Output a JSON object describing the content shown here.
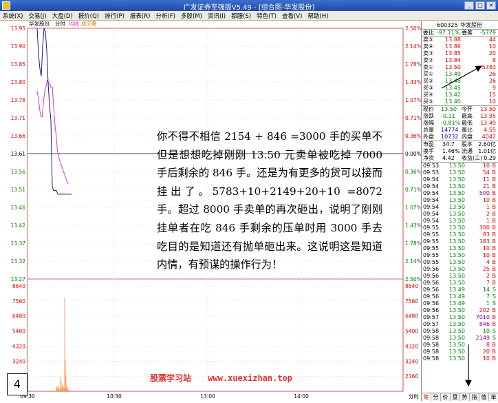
{
  "window": {
    "title": "广发证券至强版V5.49 - [组合图-华发股份]",
    "min": "_",
    "max": "□",
    "close": "×"
  },
  "menu": [
    "系统(X)",
    "交易(J)",
    "大盘(D)",
    "报价(Q)",
    "排行(P)",
    "报表(R)",
    "分析(F)",
    "多股(M)",
    "资讯(I)",
    "都服(S)",
    "特色(T)",
    "查看(V)",
    "帮助(H)"
  ],
  "chart": {
    "stock_name": "华发股份",
    "view_label": "分时",
    "avg_legend": "均线",
    "vol_legend": "成交量",
    "price_ticks": [
      "13.95",
      "13.90",
      "13.85",
      "13.80",
      "13.76",
      "13.71",
      "13.66",
      "13.61",
      "13.56",
      "13.51",
      "13.46",
      "13.42",
      "13.37",
      "13.32",
      "13.27"
    ],
    "pct_ticks": [
      "2.50%",
      "2.14%",
      "1.78%",
      "1.43%",
      "1.07%",
      "0.71%",
      "0.36%",
      "0.00%",
      "0.36%",
      "0.71%",
      "1.07%",
      "1.43%",
      "1.78%",
      "2.14%",
      "2.50%"
    ],
    "vol_ticks": [
      "8640",
      "7560",
      "6480",
      "5400",
      "4320",
      "3240",
      "2160"
    ],
    "time_ticks": [
      "09:30",
      "10:30",
      "13:00",
      "14:00"
    ],
    "time_label": "分时"
  },
  "chart_data": {
    "type": "line",
    "title": "华发股份 分时",
    "xlabel": "",
    "ylabel": "",
    "ylim": [
      13.27,
      13.95
    ],
    "prev_close": 13.61,
    "series": [
      {
        "name": "价格",
        "values": [
          13.95,
          13.88,
          13.84,
          13.82,
          13.9,
          13.95,
          13.94,
          13.89,
          13.8,
          13.74,
          13.7,
          13.52,
          13.51,
          13.51,
          13.51,
          13.5,
          13.5,
          13.5,
          13.5,
          13.5,
          13.5,
          13.5,
          13.5,
          13.5,
          13.5,
          13.5
        ]
      },
      {
        "name": "均线",
        "values": [
          13.78,
          13.76,
          13.73,
          13.71,
          13.71,
          13.75,
          13.78,
          13.79,
          13.81,
          13.8,
          13.8,
          13.79,
          13.79,
          13.74,
          13.69,
          13.66,
          13.62,
          13.6,
          13.59,
          13.58,
          13.57,
          13.56,
          13.55,
          13.54,
          13.53,
          13.53
        ]
      },
      {
        "name": "成交量",
        "values": [
          400,
          350,
          250,
          500,
          200,
          150,
          1200,
          800,
          300,
          600,
          400,
          300,
          7700,
          2600,
          1300,
          400,
          300,
          200,
          0,
          0,
          0,
          0,
          0,
          0,
          0,
          0
        ]
      }
    ],
    "vol_ylim": [
      0,
      8640
    ]
  },
  "quote": {
    "code": "600325",
    "name": "华发股份",
    "webi": {
      "label": "委比",
      "value": "-97.11%",
      "label2": "委差",
      "value2": "-5779"
    },
    "sells": [
      {
        "label": "卖⑤",
        "price": "13.88",
        "vol": "44"
      },
      {
        "label": "卖④",
        "price": "13.86",
        "vol": "10"
      },
      {
        "label": "卖③",
        "price": "13.85",
        "vol": "20"
      },
      {
        "label": "卖②",
        "price": "13.84",
        "vol": "8"
      },
      {
        "label": "卖①",
        "price": "13.50",
        "vol": "5783"
      }
    ],
    "buys": [
      {
        "label": "买①",
        "price": "13.49",
        "vol": "26"
      },
      {
        "label": "买②",
        "price": "13.48",
        "vol": "26"
      },
      {
        "label": "买③",
        "price": "13.45",
        "vol": "9"
      },
      {
        "label": "买④",
        "price": "13.42",
        "vol": "15"
      },
      {
        "label": "买⑤",
        "price": "13.40",
        "vol": "10"
      }
    ],
    "stats": [
      {
        "l1": "现价",
        "v1": "13.50",
        "l2": "今开",
        "v2": "13.50"
      },
      {
        "l1": "涨跌",
        "v1": "-0.11",
        "l2": "最高",
        "v2": "13.95"
      },
      {
        "l1": "涨幅",
        "v1": "-0.81%",
        "l2": "最低",
        "v2": "13.49"
      },
      {
        "l1": "总量",
        "v1": "14774",
        "l2": "量比",
        "v2": "4.55"
      },
      {
        "l1": "外盘",
        "v1": "10732",
        "l2": "内盘",
        "v2": "4042"
      }
    ],
    "stats2": [
      {
        "l1": "市盈",
        "v1": "34.7",
        "l2": "股本",
        "v2": "2.60亿"
      },
      {
        "l1": "换手",
        "v1": "1.46%",
        "l2": "流通",
        "v2": "1.01亿"
      },
      {
        "l1": "净资",
        "v1": "4.42",
        "l2": "收益(三)",
        "v2": "0.29"
      }
    ],
    "ticks": [
      {
        "time": "09:53",
        "price": "13.50",
        "vol": "10",
        "side": "B"
      },
      {
        "time": "09:53",
        "price": "13.50",
        "vol": "54",
        "side": "B"
      },
      {
        "time": "09:54",
        "price": "13.50",
        "vol": "11",
        "side": "B"
      },
      {
        "time": "09:54",
        "price": "13.50",
        "vol": "21",
        "side": "B"
      },
      {
        "time": "09:54",
        "price": "13.50",
        "vol": "500",
        "side": "B"
      },
      {
        "time": "09:54",
        "price": "13.50",
        "vol": "10",
        "side": "B"
      },
      {
        "time": "09:54",
        "price": "13.50",
        "vol": "1",
        "side": "B"
      },
      {
        "time": "09:54",
        "price": "13.50",
        "vol": "2",
        "side": "B"
      },
      {
        "time": "09:54",
        "price": "13.50",
        "vol": "1",
        "side": "B"
      },
      {
        "time": "09:55",
        "price": "13.50",
        "vol": "300",
        "side": "B"
      },
      {
        "time": "09:55",
        "price": "13.50",
        "vol": "83",
        "side": "B"
      },
      {
        "time": "09:55",
        "price": "13.50",
        "vol": "183",
        "side": "B"
      },
      {
        "time": "09:55",
        "price": "13.50",
        "vol": "10",
        "side": "B"
      },
      {
        "time": "09:55",
        "price": "13.50",
        "vol": "10",
        "side": "B"
      },
      {
        "time": "09:55",
        "price": "13.50",
        "vol": "4",
        "side": "B"
      },
      {
        "time": "09:56",
        "price": "13.50",
        "vol": "25",
        "side": "B"
      },
      {
        "time": "09:56",
        "price": "13.50",
        "vol": "2",
        "side": "B"
      },
      {
        "time": "09:56",
        "price": "13.50",
        "vol": "7",
        "side": "B"
      },
      {
        "time": "09:56",
        "price": "13.49",
        "vol": "14",
        "side": "S"
      },
      {
        "time": "09:56",
        "price": "13.49",
        "vol": "7",
        "side": "S"
      },
      {
        "time": "09:56",
        "price": "13.49",
        "vol": "1",
        "side": "S"
      },
      {
        "time": "09:56",
        "price": "13.50",
        "vol": "202",
        "side": "B"
      },
      {
        "time": "09:57",
        "price": "13.50",
        "vol": "7010",
        "side": "B"
      },
      {
        "time": "09:57",
        "price": "13.50",
        "vol": "846",
        "side": "B"
      },
      {
        "time": "09:58",
        "price": "13.50",
        "vol": "10",
        "side": "S"
      },
      {
        "time": "09:58",
        "price": "13.50",
        "vol": "2149",
        "side": "S"
      },
      {
        "time": "09:58",
        "price": "13.50",
        "vol": "8",
        "side": "B"
      },
      {
        "time": "09:58",
        "price": "13.50",
        "vol": "20",
        "side": "B"
      },
      {
        "time": "09:58",
        "price": "13.50",
        "vol": "10",
        "side": "B"
      }
    ],
    "tabs": [
      "笔",
      "分",
      "价",
      "盘",
      "势",
      "指",
      "值",
      "单"
    ]
  },
  "annotation": {
    "text": "你不得不相信 2154 + 846 =3000 手的买单不但是想想吃掉刚刚 13.50 元卖单被吃掉 7000 手后剩余的 846 手。还是为有更多的货可以接而挂出了。5783+10+2149+20+10 =8072 手。超过 8000 手卖单的再次砸出，说明了刚刚挂单者在吃 846 手剩余的压单时用 3000 手去吃目的是知道还有抛单砸出来。这说明这是知道内情，有预谋的操作行为！"
  },
  "page_number": "4",
  "watermark": {
    "name": "股票学习站",
    "url": "www.xuexizhan.top"
  },
  "colors": {
    "up": "#e00000",
    "down": "#008000",
    "price_line": "#1a1a80",
    "avg_line": "#e030e0",
    "volume": "#ff8c40",
    "annotation_arrow": "#000000"
  }
}
